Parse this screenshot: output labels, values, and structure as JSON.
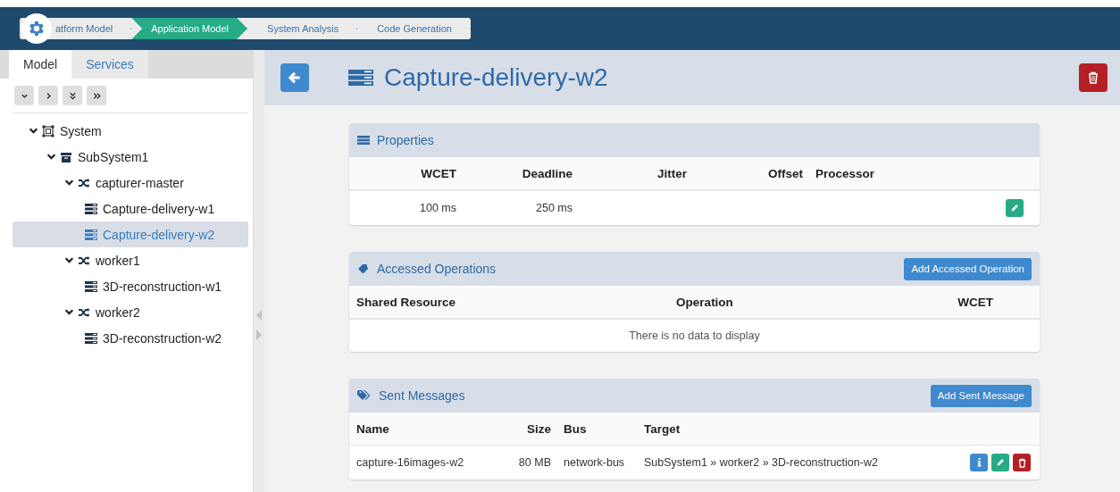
{
  "breadcrumb": [
    {
      "label": "atform Model",
      "selected": false
    },
    {
      "label": "Application Model",
      "selected": true
    },
    {
      "label": "System Analysis",
      "selected": false
    },
    {
      "label": "Code Generation",
      "selected": false
    }
  ],
  "sidebar": {
    "tabs": [
      {
        "label": "Model",
        "selected": true
      },
      {
        "label": "Services",
        "selected": false
      }
    ],
    "tree": [
      {
        "label": "System",
        "kind": "system",
        "expanded": true,
        "selected": false,
        "children": [
          {
            "label": "SubSystem1",
            "kind": "subsystem",
            "expanded": true,
            "selected": false,
            "children": [
              {
                "label": "capturer-master",
                "kind": "transaction",
                "expanded": true,
                "selected": false,
                "children": [
                  {
                    "label": "Capture-delivery-w1",
                    "kind": "task",
                    "selected": false
                  },
                  {
                    "label": "Capture-delivery-w2",
                    "kind": "task",
                    "selected": true
                  }
                ]
              },
              {
                "label": "worker1",
                "kind": "transaction",
                "expanded": true,
                "selected": false,
                "children": [
                  {
                    "label": "3D-reconstruction-w1",
                    "kind": "task",
                    "selected": false
                  }
                ]
              },
              {
                "label": "worker2",
                "kind": "transaction",
                "expanded": true,
                "selected": false,
                "children": [
                  {
                    "label": "3D-reconstruction-w2",
                    "kind": "task",
                    "selected": false
                  }
                ]
              }
            ]
          }
        ]
      }
    ]
  },
  "page": {
    "title": "Capture-delivery-w2"
  },
  "properties": {
    "title": "Properties",
    "columns": [
      "WCET",
      "Deadline",
      "Jitter",
      "Offset",
      "Processor"
    ],
    "rows": [
      {
        "cells": [
          "100 ms",
          "250 ms"
        ]
      }
    ]
  },
  "accessed_operations": {
    "title": "Accessed Operations",
    "button": "Add Accessed Operation",
    "columns": [
      "Shared Resource",
      "Operation",
      "WCET"
    ],
    "empty_message": "There is no data to display"
  },
  "sent_messages": {
    "title": "Sent Messages",
    "button": "Add Sent Message",
    "columns": [
      "Name",
      "Size",
      "Bus",
      "Target"
    ],
    "rows": [
      {
        "cells": [
          "capture-16images-w2",
          "80 MB",
          "network-bus",
          "SubSystem1 » worker2 » 3D-reconstruction-w2"
        ]
      }
    ]
  }
}
